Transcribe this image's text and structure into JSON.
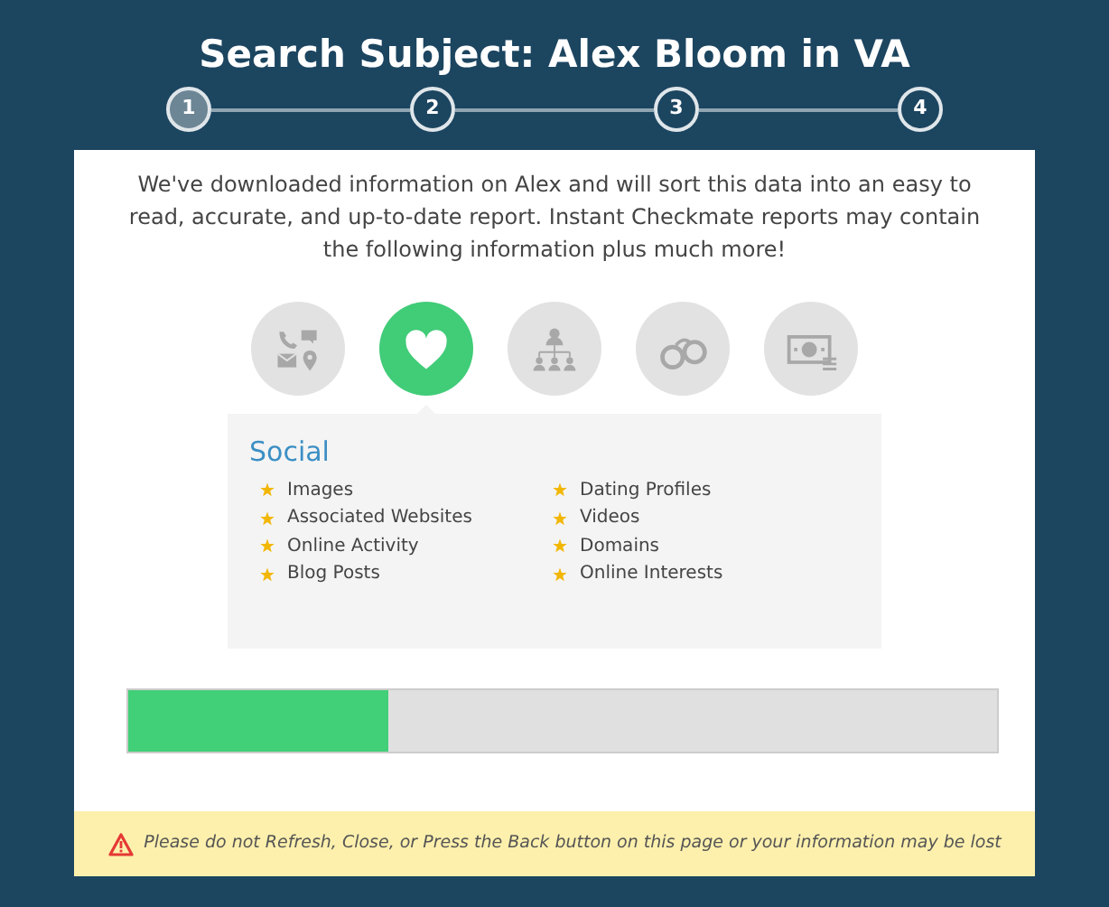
{
  "title": "Search Subject: Alex Bloom in VA",
  "steps": [
    {
      "label": "1",
      "selected": true
    },
    {
      "label": "2",
      "selected": false
    },
    {
      "label": "3",
      "selected": false
    },
    {
      "label": "4",
      "selected": false
    }
  ],
  "intro": "We've downloaded information on Alex and will sort this data into an easy to read, accurate, and up-to-date report. Instant Checkmate reports may contain the following information plus much more!",
  "categories": [
    {
      "kind": "contact",
      "selected": false
    },
    {
      "kind": "social",
      "selected": true
    },
    {
      "kind": "family",
      "selected": false
    },
    {
      "kind": "criminal",
      "selected": false
    },
    {
      "kind": "financial",
      "selected": false
    }
  ],
  "panel": {
    "heading": "Social",
    "items": [
      "Images",
      "Associated Websites",
      "Online Activity",
      "Blog Posts",
      "Dating Profiles",
      "Videos",
      "Domains",
      "Online Interests"
    ]
  },
  "progress": {
    "level": 0.3
  },
  "warning": "Please do not Refresh, Close, or Press the Back button on this page or your information may be lost"
}
